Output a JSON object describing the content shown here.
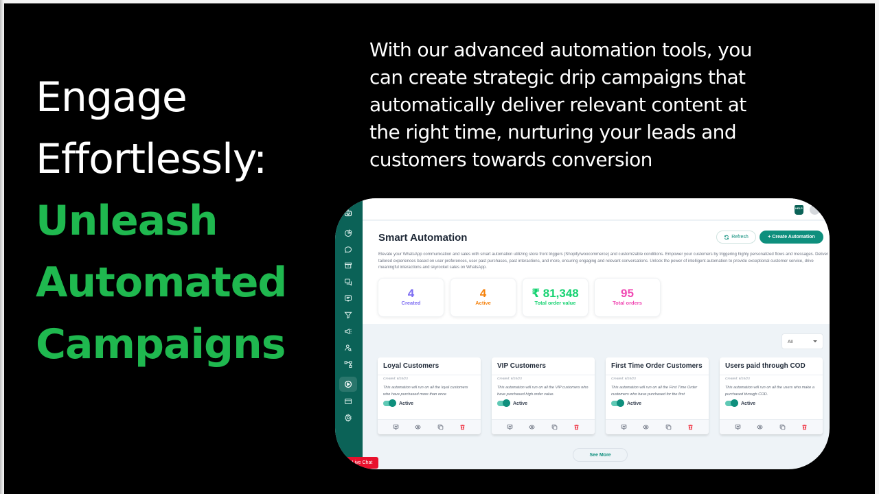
{
  "slide": {
    "headline_white": [
      "Engage",
      "Effortlessly:"
    ],
    "headline_green": [
      "Unleash",
      "Automated",
      "Campaigns"
    ],
    "blurb": "With our advanced automation tools, you can create strategic drip campaigns that automatically deliver relevant content at the right time, nurturing your leads and customers towards conversion",
    "accent_color": "#1fb84f"
  },
  "app": {
    "sidebar": {
      "icons": [
        "bot-logo-icon",
        "analytics-icon",
        "chat-icon",
        "archive-icon",
        "conversations-icon",
        "message-icon",
        "filter-icon",
        "megaphone-icon",
        "contacts-icon",
        "flow-icon",
        "automation-play-icon",
        "billing-card-icon",
        "settings-icon"
      ],
      "active": "automation-play-icon",
      "color": "#0b6257"
    },
    "topbar": {
      "help_label": "HELP"
    },
    "page_title": "Smart Automation",
    "refresh_label": "Refresh",
    "create_label": "+ Create Automation",
    "description": "Elevate your WhatsApp communication and sales with smart automation utilizing store front triggers (Shopify/woocommerce) and customizable conditions. Empower your customers by triggering highly personalized flows and messages. Deliver tailored experiences based on user preferences, user past purchases, past interactions, and more, ensuring engaging and relevant conversations. Unlock the power of intelligent automation to provide exceptional customer service, drive meaningful interactions and skyrocket sales on WhatsApp.",
    "stats": [
      {
        "value": "4",
        "label": "Created",
        "color": "#7c6cf2"
      },
      {
        "value": "4",
        "label": "Active",
        "color": "#f5820d"
      },
      {
        "value": "₹ 81,348",
        "label": "Total order value",
        "color": "#16d271"
      },
      {
        "value": "95",
        "label": "Total orders",
        "color": "#f04ab3"
      }
    ],
    "filter": {
      "selected": "All"
    },
    "cards": [
      {
        "title": "Loyal Customers",
        "created": "Created: 6/24/23",
        "description": "This automation will run on all the loyal customers who have purchased more than once",
        "status": "Active"
      },
      {
        "title": "VIP Customers",
        "created": "Created: 6/24/23",
        "description": "This automation will run on all the VIP customers who have purchased high order value.",
        "status": "Active"
      },
      {
        "title": "First Time Order Customers",
        "created": "Created: 6/24/23",
        "description": "This automation will run on all the First Time Order customers who have purchased for the first",
        "status": "Active"
      },
      {
        "title": "Users paid through COD",
        "created": "Created: 6/24/23",
        "description": "This automation will run on all the users who make a purchased through COD.",
        "status": "Active"
      }
    ],
    "card_actions": [
      "analytics-icon",
      "view-icon",
      "duplicate-icon",
      "delete-icon"
    ],
    "see_more_label": "See More",
    "live_chat_label": "Live Chat"
  }
}
